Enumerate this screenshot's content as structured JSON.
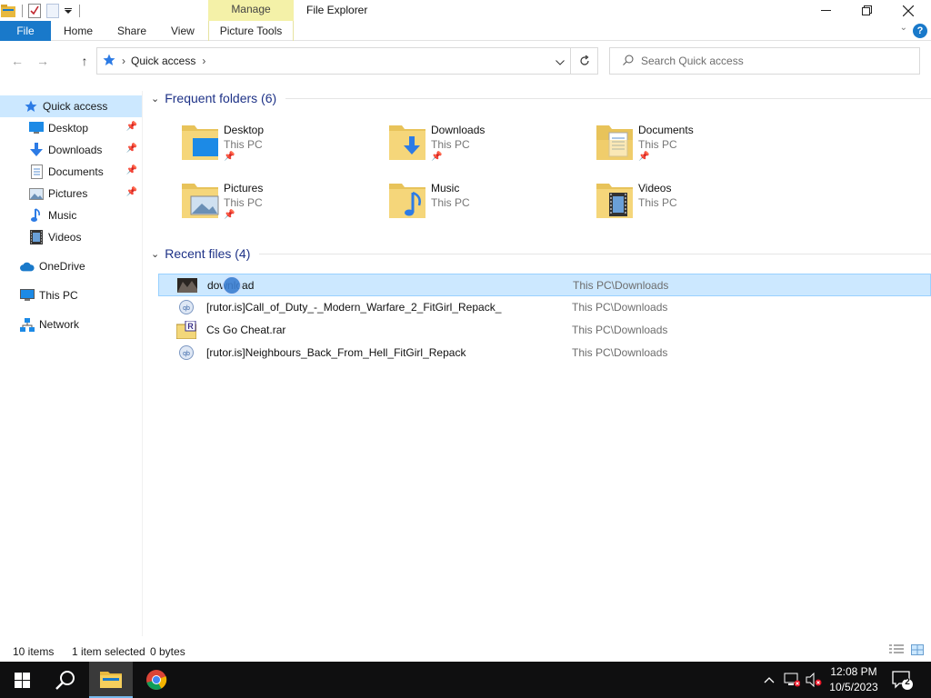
{
  "window": {
    "title": "File Explorer",
    "contextual_tab_group": "Manage",
    "minimize_icon": "minimize-icon",
    "maximize_icon": "restore-icon",
    "close_icon": "close-icon"
  },
  "ribbon": {
    "tabs": [
      {
        "label": "File"
      },
      {
        "label": "Home"
      },
      {
        "label": "Share"
      },
      {
        "label": "View"
      },
      {
        "label": "Picture Tools"
      }
    ],
    "help_label": "?"
  },
  "address": {
    "path": "Quick access",
    "search_placeholder": "Search Quick access"
  },
  "sidebar": {
    "items": [
      {
        "label": "Quick access",
        "icon": "star-icon",
        "active": true
      },
      {
        "label": "Desktop",
        "icon": "desktop-icon",
        "pinned": true
      },
      {
        "label": "Downloads",
        "icon": "downloads-icon",
        "pinned": true
      },
      {
        "label": "Documents",
        "icon": "documents-icon",
        "pinned": true
      },
      {
        "label": "Pictures",
        "icon": "pictures-icon",
        "pinned": true
      },
      {
        "label": "Music",
        "icon": "music-icon"
      },
      {
        "label": "Videos",
        "icon": "videos-icon"
      },
      {
        "label": "OneDrive",
        "icon": "cloud-icon"
      },
      {
        "label": "This PC",
        "icon": "computer-icon"
      },
      {
        "label": "Network",
        "icon": "network-icon"
      }
    ]
  },
  "frequent": {
    "heading": "Frequent folders (6)",
    "folders": [
      {
        "name": "Desktop",
        "location": "This PC",
        "pinned": true
      },
      {
        "name": "Downloads",
        "location": "This PC",
        "pinned": true
      },
      {
        "name": "Documents",
        "location": "This PC",
        "pinned": true
      },
      {
        "name": "Pictures",
        "location": "This PC",
        "pinned": true
      },
      {
        "name": "Music",
        "location": "This PC",
        "pinned": false
      },
      {
        "name": "Videos",
        "location": "This PC",
        "pinned": false
      }
    ]
  },
  "recent": {
    "heading": "Recent files (4)",
    "files": [
      {
        "name": "download",
        "location": "This PC\\Downloads",
        "icon": "image-thumbnail-icon",
        "selected": true
      },
      {
        "name": "[rutor.is]Call_of_Duty_-_Modern_Warfare_2_FitGirl_Repack_",
        "location": "This PC\\Downloads",
        "icon": "torrent-icon",
        "selected": false
      },
      {
        "name": "Cs Go Cheat.rar",
        "location": "This PC\\Downloads",
        "icon": "rar-archive-icon",
        "selected": false
      },
      {
        "name": "[rutor.is]Neighbours_Back_From_Hell_FitGirl_Repack",
        "location": "This PC\\Downloads",
        "icon": "torrent-icon",
        "selected": false
      }
    ]
  },
  "status": {
    "item_count": "10 items",
    "selection": "1 item selected",
    "size": "0 bytes"
  },
  "taskbar": {
    "time": "12:08 PM",
    "date": "10/5/2023",
    "notification_count": "2"
  },
  "colors": {
    "accent": "#1979ca",
    "selection": "#cce8ff",
    "manage_tab": "#f4f1a8",
    "heading": "#1e3287",
    "taskbar": "#0f0f10"
  }
}
